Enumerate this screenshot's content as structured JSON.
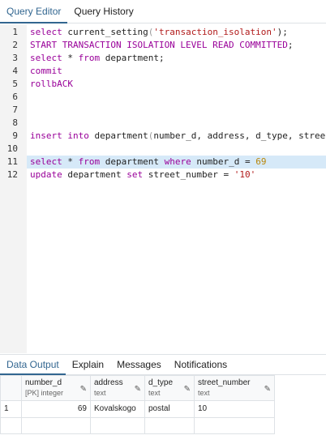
{
  "tabs": {
    "editor": "Query Editor",
    "history": "Query History"
  },
  "editor": {
    "lines": [
      {
        "n": "1",
        "tokens": [
          {
            "t": "select",
            "c": "kw"
          },
          {
            "t": " current_setting",
            "c": ""
          },
          {
            "t": "(",
            "c": "paren"
          },
          {
            "t": "'transaction_isolation'",
            "c": "str"
          },
          {
            "t": ");",
            "c": ""
          }
        ]
      },
      {
        "n": "2",
        "tokens": [
          {
            "t": "START TRANSACTION ISOLATION LEVEL READ COMMITTED",
            "c": "kw"
          },
          {
            "t": ";",
            "c": ""
          }
        ]
      },
      {
        "n": "3",
        "tokens": [
          {
            "t": "select",
            "c": "kw"
          },
          {
            "t": " * ",
            "c": ""
          },
          {
            "t": "from",
            "c": "kw"
          },
          {
            "t": " department;",
            "c": ""
          }
        ]
      },
      {
        "n": "4",
        "tokens": [
          {
            "t": "commit",
            "c": "kw"
          }
        ]
      },
      {
        "n": "5",
        "tokens": [
          {
            "t": "rollbACK",
            "c": "kw"
          }
        ]
      },
      {
        "n": "6",
        "tokens": []
      },
      {
        "n": "7",
        "tokens": []
      },
      {
        "n": "8",
        "tokens": []
      },
      {
        "n": "9",
        "tokens": [
          {
            "t": "insert into",
            "c": "kw"
          },
          {
            "t": " department",
            "c": ""
          },
          {
            "t": "(",
            "c": "paren"
          },
          {
            "t": "number_d, address, d_type, street_number",
            "c": ""
          }
        ]
      },
      {
        "n": "10",
        "tokens": []
      },
      {
        "n": "11",
        "highlight": true,
        "tokens": [
          {
            "t": "select",
            "c": "kw"
          },
          {
            "t": " * ",
            "c": ""
          },
          {
            "t": "from",
            "c": "kw"
          },
          {
            "t": " department ",
            "c": ""
          },
          {
            "t": "where",
            "c": "kw"
          },
          {
            "t": " number_d = ",
            "c": ""
          },
          {
            "t": "69",
            "c": "num"
          }
        ]
      },
      {
        "n": "12",
        "tokens": [
          {
            "t": "update",
            "c": "kw"
          },
          {
            "t": " department ",
            "c": ""
          },
          {
            "t": "set",
            "c": "kw"
          },
          {
            "t": " street_number = ",
            "c": ""
          },
          {
            "t": "'10'",
            "c": "str"
          }
        ]
      }
    ]
  },
  "panel_tabs": {
    "data_output": "Data Output",
    "explain": "Explain",
    "messages": "Messages",
    "notifications": "Notifications"
  },
  "grid": {
    "columns": [
      {
        "name": "number_d",
        "type": "[PK] integer"
      },
      {
        "name": "address",
        "type": "text"
      },
      {
        "name": "d_type",
        "type": "text"
      },
      {
        "name": "street_number",
        "type": "text"
      }
    ],
    "rows": [
      {
        "n": "1",
        "cells": [
          "69",
          "Kovalskogo",
          "postal",
          "10"
        ]
      }
    ]
  },
  "icons": {
    "edit": "pencil-icon"
  },
  "colors": {
    "accent": "#326690",
    "keyword": "#990099",
    "string": "#b11a1a",
    "number": "#b8860b",
    "highlight": "#d6e9f8",
    "gutter": "#f3f3f3"
  }
}
